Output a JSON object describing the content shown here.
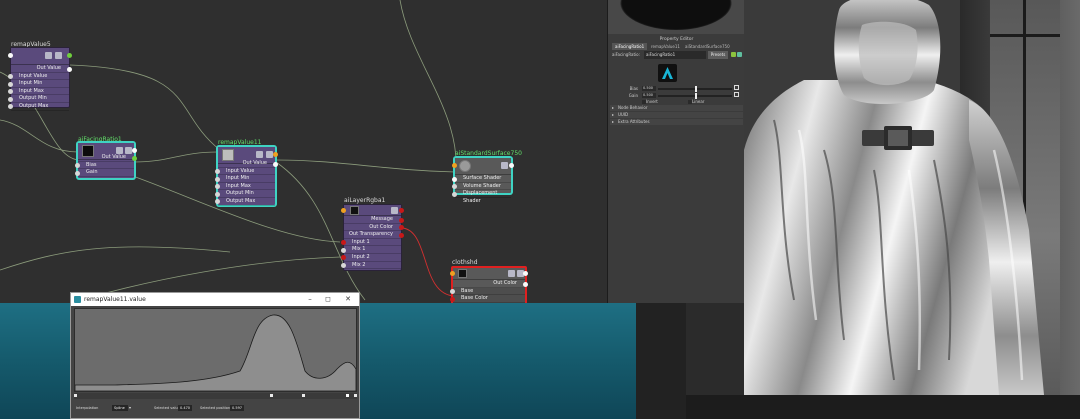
{
  "colors": {
    "node_body": "#5a4a7c",
    "selection": "#3fd3c3",
    "title_green": "#62e06a",
    "port_red": "#c81818",
    "viewport_teal": "#1e6f83"
  },
  "nodes": {
    "remap5": {
      "title": "remapValue5",
      "out": "Out Value",
      "inputs": [
        "Input Value",
        "Input Min",
        "Input Max",
        "Output Min",
        "Output Max"
      ]
    },
    "facing": {
      "title": "aiFacingRatio1",
      "out": "Out Value",
      "inputs": [
        "Bias",
        "Gain"
      ]
    },
    "remap11": {
      "title": "remapValue11",
      "out": "Out Value",
      "inputs": [
        "Input Value",
        "Input Min",
        "Input Max",
        "Output Min",
        "Output Max"
      ]
    },
    "surface": {
      "title": "aiStandardSurface750",
      "inputs": [
        "Surface Shader",
        "Volume Shader",
        "Displacement Shader"
      ]
    },
    "layer": {
      "title": "aiLayerRgba1",
      "outputs": [
        "Message",
        "Out Color",
        "Out Transparency"
      ],
      "inputs": [
        "Input 1",
        "Mix 1",
        "Input 2",
        "Mix 2"
      ]
    },
    "cloth": {
      "title": "clothshd",
      "out": "Out Color",
      "inputs": [
        "Base",
        "Base Color"
      ]
    }
  },
  "property_editor": {
    "title": "Property Editor",
    "tabs": [
      "aiFacingRatio1",
      "remapValue11",
      "aiStandardSurface750"
    ],
    "node_label": "aiFacingRatio:",
    "node_value": "aiFacingRatio1",
    "focus_button": "Presets",
    "bias_label": "Bias",
    "bias_value": "0.500",
    "bias_fraction": 0.5,
    "gain_label": "Gain",
    "gain_value": "0.500",
    "gain_fraction": 0.5,
    "invert_label": "Invert",
    "linear_label": "Linear",
    "sections": [
      "Node Behavior",
      "UUID",
      "Extra Attributes"
    ]
  },
  "ramp": {
    "title": "remapValue11.value",
    "interpolation_label": "Interpolation",
    "interpolation_value": "Spline",
    "selected_value_label": "Selected value",
    "selected_value": "0.470",
    "selected_position_label": "Selected position",
    "selected_position": "0.597"
  },
  "icons": {
    "arnold": "arnold-logo-icon",
    "minimize": "minimize-icon",
    "maximize": "maximize-icon",
    "close": "close-icon"
  }
}
